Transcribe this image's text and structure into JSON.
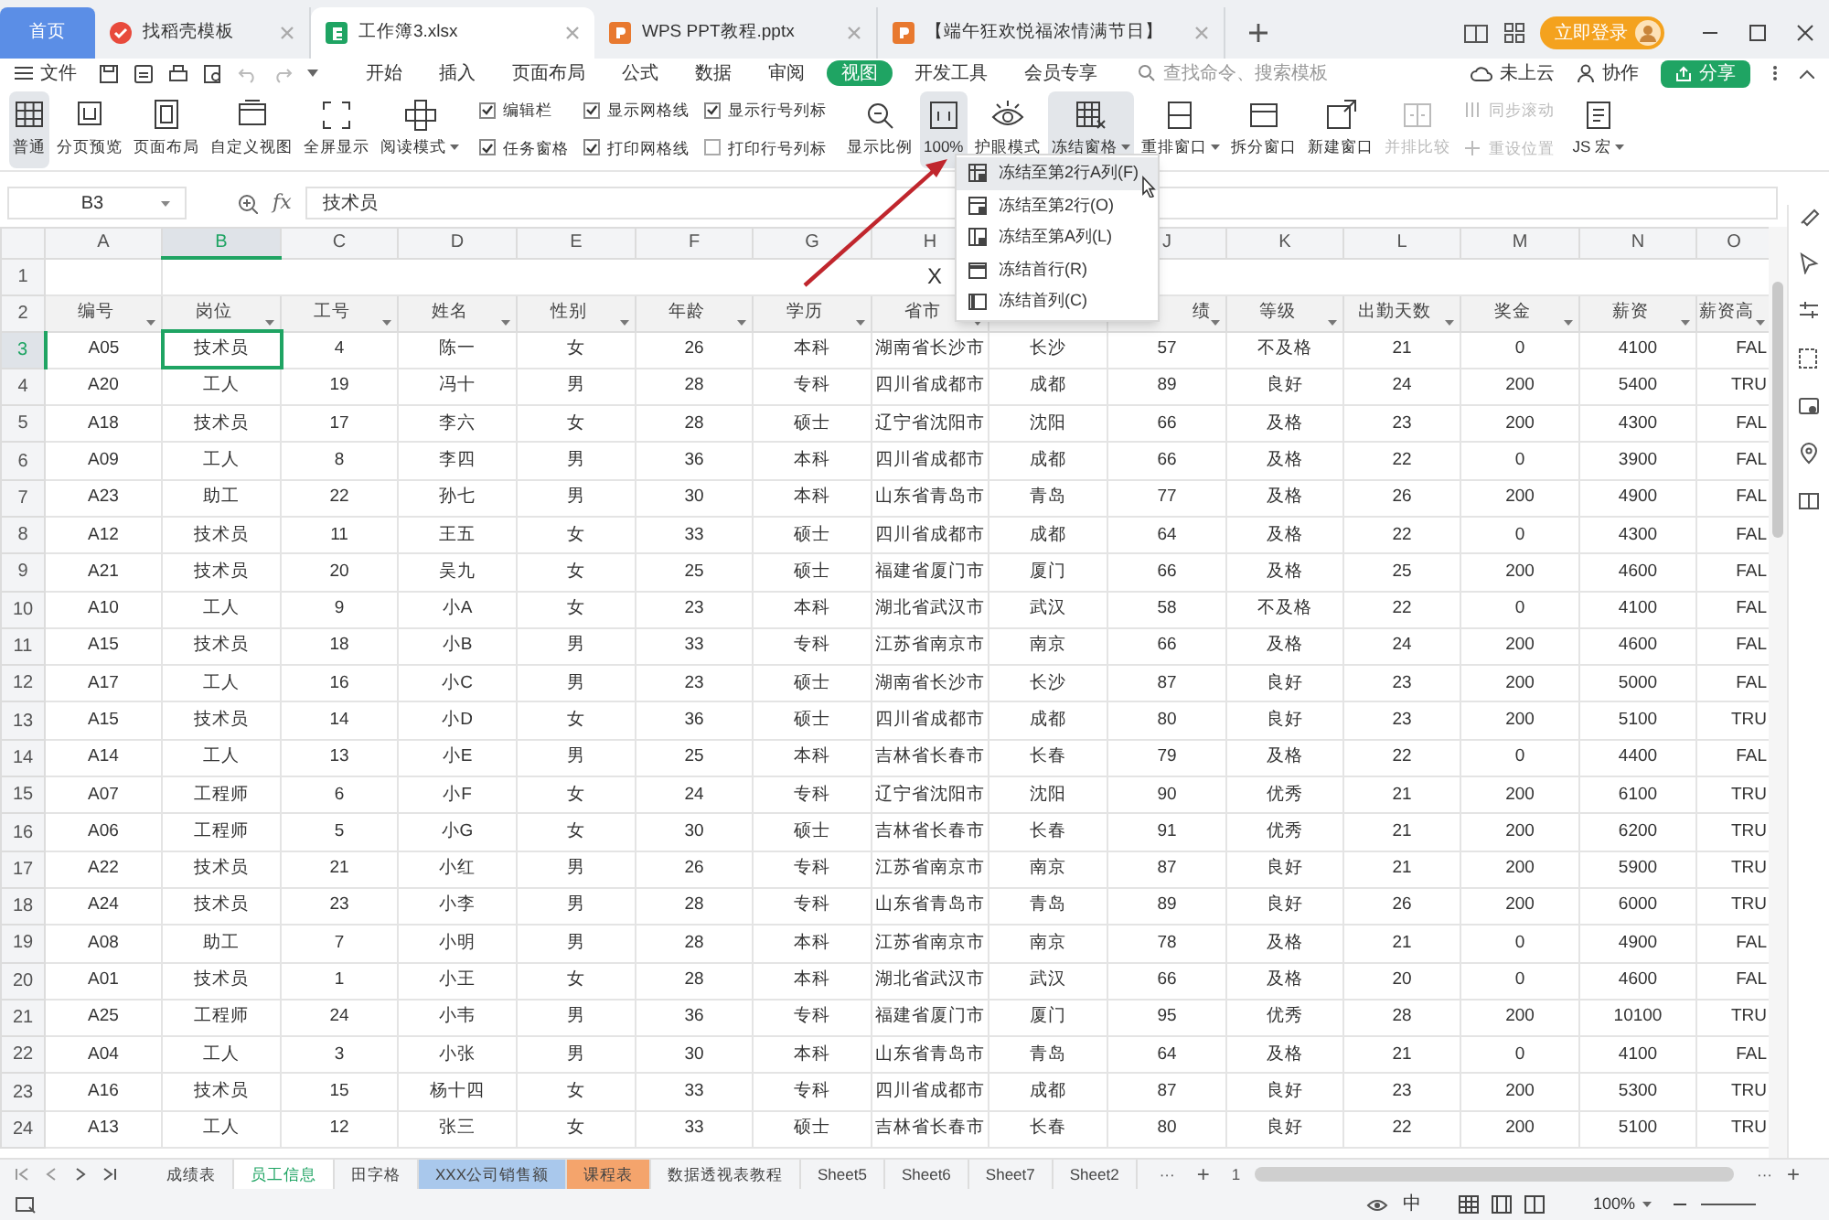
{
  "app_tabs": [
    {
      "label": "首页",
      "kind": "home",
      "selected": false
    },
    {
      "label": "找稻壳模板",
      "kind": "docer",
      "selected": false
    },
    {
      "label": "工作簿3.xlsx",
      "kind": "sheet",
      "selected": true
    },
    {
      "label": "WPS PPT教程.pptx",
      "kind": "ppt",
      "selected": false
    },
    {
      "label": "【端午狂欢悦福浓情满节日】",
      "kind": "ppt",
      "selected": false
    }
  ],
  "login_button": "立即登录",
  "menu": {
    "file": "文件",
    "items": [
      {
        "label": "开始",
        "selected": false
      },
      {
        "label": "插入",
        "selected": false
      },
      {
        "label": "页面布局",
        "selected": false
      },
      {
        "label": "公式",
        "selected": false
      },
      {
        "label": "数据",
        "selected": false
      },
      {
        "label": "审阅",
        "selected": false
      },
      {
        "label": "视图",
        "selected": true
      },
      {
        "label": "开发工具",
        "selected": false
      },
      {
        "label": "会员专享",
        "selected": false
      }
    ],
    "search_placeholder": "查找命令、搜索模板",
    "cloud": "未上云",
    "collab": "协作",
    "share": "分享"
  },
  "ribbon": {
    "view_buttons": [
      {
        "label": "普通",
        "selected": true,
        "dropdown": false
      },
      {
        "label": "分页预览",
        "selected": false,
        "dropdown": false
      },
      {
        "label": "页面布局",
        "selected": false,
        "dropdown": false
      },
      {
        "label": "自定义视图",
        "selected": false,
        "dropdown": false
      },
      {
        "label": "全屏显示",
        "selected": false,
        "dropdown": false
      },
      {
        "label": "阅读模式",
        "selected": false,
        "dropdown": true
      }
    ],
    "checkboxes": [
      {
        "label": "编辑栏",
        "checked": true
      },
      {
        "label": "任务窗格",
        "checked": true
      },
      {
        "label": "显示网格线",
        "checked": true
      },
      {
        "label": "打印网格线",
        "checked": true
      },
      {
        "label": "显示行号列标",
        "checked": true
      },
      {
        "label": "打印行号列标",
        "checked": false
      }
    ],
    "zoom_buttons": [
      {
        "label": "显示比例",
        "selected": false
      },
      {
        "label": "100%",
        "selected": true
      }
    ],
    "window_buttons": [
      {
        "label": "护眼模式",
        "selected": false,
        "dropdown": false,
        "disabled": false
      },
      {
        "label": "冻结窗格",
        "selected": true,
        "dropdown": true,
        "disabled": false
      },
      {
        "label": "重排窗口",
        "selected": false,
        "dropdown": true,
        "disabled": false
      },
      {
        "label": "拆分窗口",
        "selected": false,
        "dropdown": false,
        "disabled": false
      },
      {
        "label": "新建窗口",
        "selected": false,
        "dropdown": false,
        "disabled": false
      },
      {
        "label": "并排比较",
        "selected": false,
        "dropdown": false,
        "disabled": true
      }
    ],
    "small_buttons": [
      {
        "label": "同步滚动",
        "disabled": true
      },
      {
        "label": "重设位置",
        "disabled": true
      }
    ],
    "macro_button": {
      "label": "JS 宏",
      "dropdown": true
    }
  },
  "formula_bar": {
    "name_box": "B3",
    "fx": "fx",
    "value": "技术员"
  },
  "freeze_menu": [
    {
      "label": "冻结至第2行A列(F)",
      "selected": true
    },
    {
      "label": "冻结至第2行(O)",
      "selected": false
    },
    {
      "label": "冻结至第A列(L)",
      "selected": false
    },
    {
      "label": "冻结首行(R)",
      "selected": false
    },
    {
      "label": "冻结首列(C)",
      "selected": false
    }
  ],
  "sheet": {
    "columns": [
      {
        "letter": "A",
        "header": "编号",
        "selected": false
      },
      {
        "letter": "B",
        "header": "岗位",
        "selected": true
      },
      {
        "letter": "C",
        "header": "工号",
        "selected": false
      },
      {
        "letter": "D",
        "header": "姓名",
        "selected": false
      },
      {
        "letter": "E",
        "header": "性别",
        "selected": false
      },
      {
        "letter": "F",
        "header": "年龄",
        "selected": false
      },
      {
        "letter": "G",
        "header": "学历",
        "selected": false
      },
      {
        "letter": "H",
        "header": "省市",
        "selected": false
      },
      {},
      {
        "letter": "J",
        "header": "绩",
        "selected": false
      },
      {
        "letter": "K",
        "header": "等级",
        "selected": false
      },
      {
        "letter": "L",
        "header": "出勤天数",
        "selected": false
      },
      {
        "letter": "M",
        "header": "奖金",
        "selected": false
      },
      {
        "letter": "N",
        "header": "薪资",
        "selected": false
      },
      {
        "letter": "O",
        "header": "薪资高",
        "selected": false
      }
    ],
    "title_row": {
      "number": "1",
      "text": "X"
    },
    "header_row_number": "2",
    "rows": [
      {
        "number": "3",
        "selected": true,
        "cells": [
          "A05",
          "技术员",
          "4",
          "陈一",
          "女",
          "26",
          "本科",
          "湖南省长沙市",
          "长沙",
          "57",
          "不及格",
          "21",
          "0",
          "4100",
          "FAL"
        ]
      },
      {
        "number": "4",
        "selected": false,
        "cells": [
          "A20",
          "工人",
          "19",
          "冯十",
          "男",
          "28",
          "专科",
          "四川省成都市",
          "成都",
          "89",
          "良好",
          "24",
          "200",
          "5400",
          "TRU"
        ]
      },
      {
        "number": "5",
        "selected": false,
        "cells": [
          "A18",
          "技术员",
          "17",
          "李六",
          "女",
          "28",
          "硕士",
          "辽宁省沈阳市",
          "沈阳",
          "66",
          "及格",
          "23",
          "200",
          "4300",
          "FAL"
        ]
      },
      {
        "number": "6",
        "selected": false,
        "cells": [
          "A09",
          "工人",
          "8",
          "李四",
          "男",
          "36",
          "本科",
          "四川省成都市",
          "成都",
          "66",
          "及格",
          "22",
          "0",
          "3900",
          "FAL"
        ]
      },
      {
        "number": "7",
        "selected": false,
        "cells": [
          "A23",
          "助工",
          "22",
          "孙七",
          "男",
          "30",
          "本科",
          "山东省青岛市",
          "青岛",
          "77",
          "及格",
          "26",
          "200",
          "4900",
          "FAL"
        ]
      },
      {
        "number": "8",
        "selected": false,
        "cells": [
          "A12",
          "技术员",
          "11",
          "王五",
          "女",
          "33",
          "硕士",
          "四川省成都市",
          "成都",
          "64",
          "及格",
          "22",
          "0",
          "4300",
          "FAL"
        ]
      },
      {
        "number": "9",
        "selected": false,
        "cells": [
          "A21",
          "技术员",
          "20",
          "吴九",
          "女",
          "25",
          "硕士",
          "福建省厦门市",
          "厦门",
          "66",
          "及格",
          "25",
          "200",
          "4600",
          "FAL"
        ]
      },
      {
        "number": "10",
        "selected": false,
        "cells": [
          "A10",
          "工人",
          "9",
          "小A",
          "女",
          "23",
          "本科",
          "湖北省武汉市",
          "武汉",
          "58",
          "不及格",
          "22",
          "0",
          "4100",
          "FAL"
        ]
      },
      {
        "number": "11",
        "selected": false,
        "cells": [
          "A15",
          "技术员",
          "18",
          "小B",
          "男",
          "33",
          "专科",
          "江苏省南京市",
          "南京",
          "66",
          "及格",
          "24",
          "200",
          "4600",
          "FAL"
        ]
      },
      {
        "number": "12",
        "selected": false,
        "cells": [
          "A17",
          "工人",
          "16",
          "小C",
          "男",
          "23",
          "硕士",
          "湖南省长沙市",
          "长沙",
          "87",
          "良好",
          "23",
          "200",
          "5000",
          "FAL"
        ]
      },
      {
        "number": "13",
        "selected": false,
        "cells": [
          "A15",
          "技术员",
          "14",
          "小D",
          "女",
          "36",
          "硕士",
          "四川省成都市",
          "成都",
          "80",
          "良好",
          "23",
          "200",
          "5100",
          "TRU"
        ]
      },
      {
        "number": "14",
        "selected": false,
        "cells": [
          "A14",
          "工人",
          "13",
          "小E",
          "男",
          "25",
          "本科",
          "吉林省长春市",
          "长春",
          "79",
          "及格",
          "22",
          "0",
          "4400",
          "FAL"
        ]
      },
      {
        "number": "15",
        "selected": false,
        "cells": [
          "A07",
          "工程师",
          "6",
          "小F",
          "女",
          "24",
          "专科",
          "辽宁省沈阳市",
          "沈阳",
          "90",
          "优秀",
          "21",
          "200",
          "6100",
          "TRU"
        ]
      },
      {
        "number": "16",
        "selected": false,
        "cells": [
          "A06",
          "工程师",
          "5",
          "小G",
          "女",
          "30",
          "硕士",
          "吉林省长春市",
          "长春",
          "91",
          "优秀",
          "21",
          "200",
          "6200",
          "TRU"
        ]
      },
      {
        "number": "17",
        "selected": false,
        "cells": [
          "A22",
          "技术员",
          "21",
          "小红",
          "男",
          "26",
          "专科",
          "江苏省南京市",
          "南京",
          "87",
          "良好",
          "21",
          "200",
          "5900",
          "TRU"
        ]
      },
      {
        "number": "18",
        "selected": false,
        "cells": [
          "A24",
          "技术员",
          "23",
          "小李",
          "男",
          "28",
          "专科",
          "山东省青岛市",
          "青岛",
          "89",
          "良好",
          "26",
          "200",
          "6000",
          "TRU"
        ]
      },
      {
        "number": "19",
        "selected": false,
        "cells": [
          "A08",
          "助工",
          "7",
          "小明",
          "男",
          "28",
          "本科",
          "江苏省南京市",
          "南京",
          "78",
          "及格",
          "21",
          "0",
          "4900",
          "FAL"
        ]
      },
      {
        "number": "20",
        "selected": false,
        "cells": [
          "A01",
          "技术员",
          "1",
          "小王",
          "女",
          "28",
          "本科",
          "湖北省武汉市",
          "武汉",
          "66",
          "及格",
          "20",
          "0",
          "4600",
          "FAL"
        ]
      },
      {
        "number": "21",
        "selected": false,
        "cells": [
          "A25",
          "工程师",
          "24",
          "小韦",
          "男",
          "36",
          "专科",
          "福建省厦门市",
          "厦门",
          "95",
          "优秀",
          "28",
          "200",
          "10100",
          "TRU"
        ]
      },
      {
        "number": "22",
        "selected": false,
        "cells": [
          "A04",
          "工人",
          "3",
          "小张",
          "男",
          "30",
          "本科",
          "山东省青岛市",
          "青岛",
          "64",
          "及格",
          "21",
          "0",
          "4100",
          "FAL"
        ]
      },
      {
        "number": "23",
        "selected": false,
        "cells": [
          "A16",
          "技术员",
          "15",
          "杨十四",
          "女",
          "33",
          "专科",
          "四川省成都市",
          "成都",
          "87",
          "良好",
          "23",
          "200",
          "5300",
          "TRU"
        ]
      },
      {
        "number": "24",
        "selected": false,
        "cells": [
          "A13",
          "工人",
          "12",
          "张三",
          "女",
          "33",
          "硕士",
          "吉林省长春市",
          "长春",
          "80",
          "良好",
          "22",
          "200",
          "5100",
          "TRU"
        ]
      }
    ]
  },
  "sheet_tabs": [
    {
      "label": "成绩表",
      "selected": false
    },
    {
      "label": "员工信息",
      "selected": true
    },
    {
      "label": "田字格",
      "selected": false
    },
    {
      "label": "XXX公司销售额",
      "selected": false,
      "color": "#a9c8ec"
    },
    {
      "label": "课程表",
      "selected": false,
      "color": "#f4a46c"
    },
    {
      "label": "数据透视表教程",
      "selected": false
    },
    {
      "label": "Sheet5",
      "selected": false
    },
    {
      "label": "Sheet6",
      "selected": false
    },
    {
      "label": "Sheet7",
      "selected": false
    },
    {
      "label": "Sheet2",
      "selected": false
    }
  ],
  "sheet_nav": {
    "more": "···",
    "add": "+",
    "page": "1"
  },
  "status_bar": {
    "input_mode": "中",
    "zoom": "100%"
  }
}
